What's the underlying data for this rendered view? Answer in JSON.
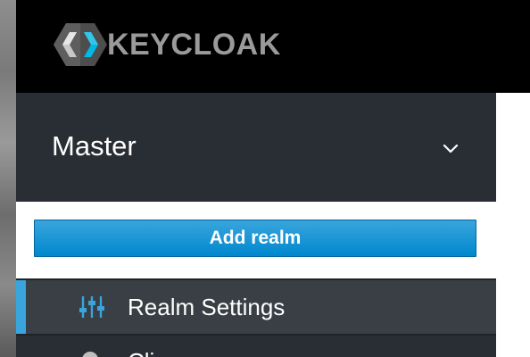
{
  "header": {
    "logo_text": "KEYCLOAK",
    "logo_icon": "keycloak-logo-icon"
  },
  "sidebar": {
    "realm_selector": {
      "current_realm": "Master",
      "icon": "chevron-down-icon"
    },
    "dropdown": {
      "add_realm_label": "Add realm"
    },
    "items": [
      {
        "label": "Realm Settings",
        "icon": "sliders-icon",
        "active": true
      },
      {
        "label": "Cli",
        "icon": "clients-icon",
        "active": false
      }
    ]
  },
  "colors": {
    "header_bg": "#000000",
    "sidebar_bg": "#292e34",
    "active_item_bg": "#393f44",
    "accent": "#39a5dc",
    "button_bg": "#0088ce",
    "logo_gray": "#9a9a9a"
  }
}
